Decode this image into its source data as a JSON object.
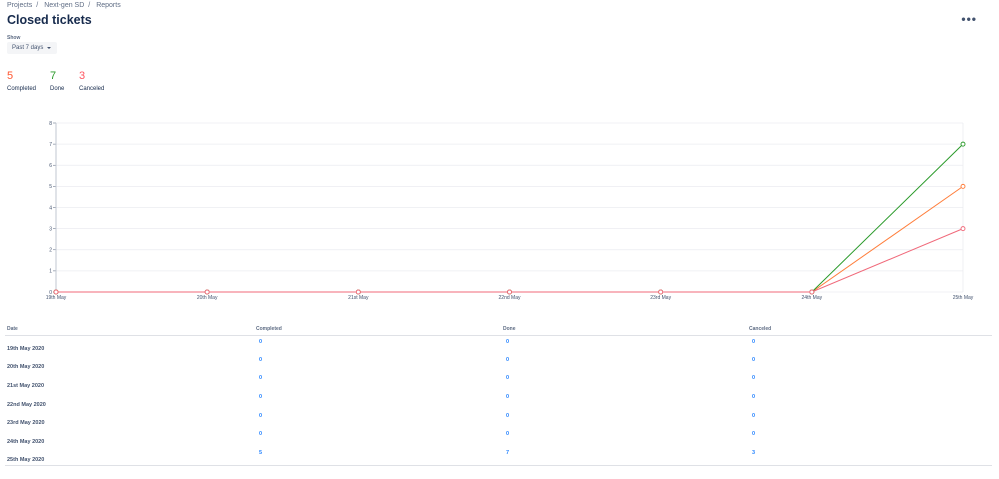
{
  "breadcrumb": [
    "Projects",
    "Next-gen SD",
    "Reports"
  ],
  "title": "Closed tickets",
  "more_icon": "more-horizontal-icon",
  "filter": {
    "label": "Show",
    "value": "Past 7 days"
  },
  "stats": [
    {
      "value": "5",
      "label": "Completed",
      "color": "#ff5630"
    },
    {
      "value": "7",
      "label": "Done",
      "color": "#36b37e"
    },
    {
      "value": "3",
      "label": "Canceled",
      "color": "#ff5661"
    }
  ],
  "chart_data": {
    "type": "line",
    "categories": [
      "19th May",
      "20th May",
      "21st May",
      "22nd May",
      "23rd May",
      "24th May",
      "25th May"
    ],
    "ylim": [
      0,
      8
    ],
    "yticks": [
      "0",
      "1",
      "2",
      "3",
      "4",
      "5",
      "6",
      "7",
      "8"
    ],
    "series": [
      {
        "name": "Completed",
        "color": "#ff7d3a",
        "values": [
          0,
          0,
          0,
          0,
          0,
          0,
          5
        ]
      },
      {
        "name": "Done",
        "color": "#2a9a2a",
        "values": [
          0,
          0,
          0,
          0,
          0,
          0,
          7
        ]
      },
      {
        "name": "Canceled",
        "color": "#f0697a",
        "values": [
          0,
          0,
          0,
          0,
          0,
          0,
          3
        ]
      }
    ]
  },
  "table": {
    "headers": [
      "Date",
      "Completed",
      "Done",
      "Canceled"
    ],
    "rows": [
      [
        "19th May 2020",
        "0",
        "0",
        "0"
      ],
      [
        "20th May 2020",
        "0",
        "0",
        "0"
      ],
      [
        "21st May 2020",
        "0",
        "0",
        "0"
      ],
      [
        "22nd May 2020",
        "0",
        "0",
        "0"
      ],
      [
        "23rd May 2020",
        "0",
        "0",
        "0"
      ],
      [
        "24th May 2020",
        "0",
        "0",
        "0"
      ],
      [
        "25th May 2020",
        "5",
        "7",
        "3"
      ]
    ]
  }
}
